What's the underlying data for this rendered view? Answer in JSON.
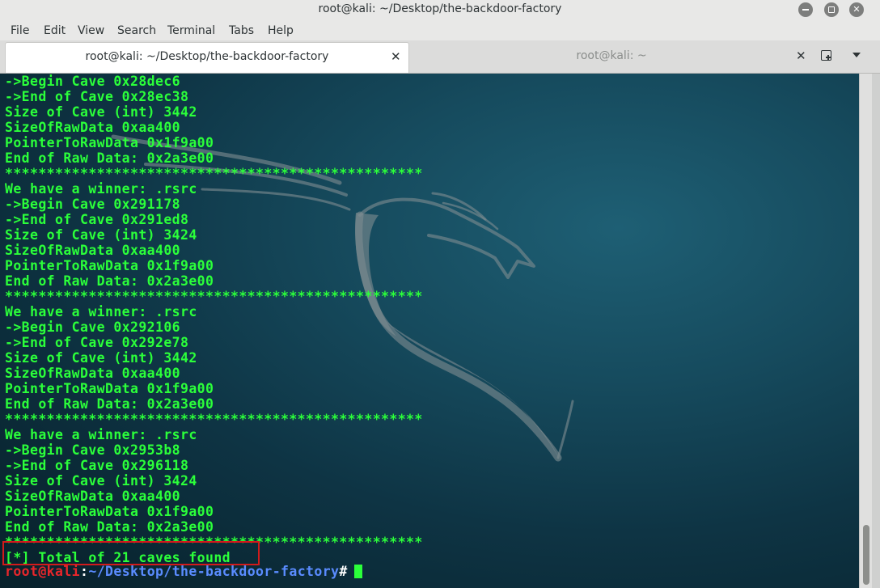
{
  "window": {
    "title": "root@kali: ~/Desktop/the-backdoor-factory"
  },
  "menu": [
    "File",
    "Edit",
    "View",
    "Search",
    "Terminal",
    "Tabs",
    "Help"
  ],
  "tabs": [
    {
      "label": "root@kali: ~/Desktop/the-backdoor-factory",
      "active": true
    },
    {
      "label": "root@kali: ~",
      "active": false
    }
  ],
  "terminal": {
    "lines": [
      "->Begin Cave 0x28dec6",
      "->End of Cave 0x28ec38",
      "Size of Cave (int) 3442",
      "SizeOfRawData 0xaa400",
      "PointerToRawData 0x1f9a00",
      "End of Raw Data: 0x2a3e00",
      "**************************************************",
      "We have a winner: .rsrc",
      "->Begin Cave 0x291178",
      "->End of Cave 0x291ed8",
      "Size of Cave (int) 3424",
      "SizeOfRawData 0xaa400",
      "PointerToRawData 0x1f9a00",
      "End of Raw Data: 0x2a3e00",
      "**************************************************",
      "We have a winner: .rsrc",
      "->Begin Cave 0x292106",
      "->End of Cave 0x292e78",
      "Size of Cave (int) 3442",
      "SizeOfRawData 0xaa400",
      "PointerToRawData 0x1f9a00",
      "End of Raw Data: 0x2a3e00",
      "**************************************************",
      "We have a winner: .rsrc",
      "->Begin Cave 0x2953b8",
      "->End of Cave 0x296118",
      "Size of Cave (int) 3424",
      "SizeOfRawData 0xaa400",
      "PointerToRawData 0x1f9a00",
      "End of Raw Data: 0x2a3e00",
      "**************************************************",
      "[*] Total of 21 caves found"
    ],
    "prompt": {
      "user": "root@kali",
      "separator": ":",
      "path": "~/Desktop/the-backdoor-factory",
      "symbol": "#"
    }
  },
  "colors": {
    "output_text": "#2bff3a",
    "prompt_user": "#e8262b",
    "prompt_path": "#5a8cff",
    "highlight_box": "#d21b1b"
  },
  "icons": {
    "minimize": "minimize-icon",
    "maximize": "maximize-icon",
    "close": "close-icon",
    "new_tab": "new-tab-icon",
    "tabs_menu": "chevron-down-icon",
    "background_logo": "kali-dragon-icon"
  }
}
